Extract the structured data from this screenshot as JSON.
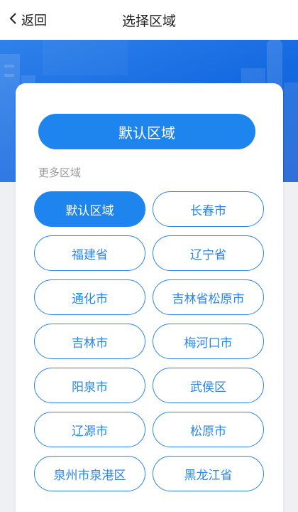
{
  "nav": {
    "back_label": "返回",
    "title": "选择区域"
  },
  "default_button_label": "默认区域",
  "section_label": "更多区域",
  "regions": [
    {
      "label": "默认区域",
      "selected": true
    },
    {
      "label": "长春市",
      "selected": false
    },
    {
      "label": "福建省",
      "selected": false
    },
    {
      "label": "辽宁省",
      "selected": false
    },
    {
      "label": "通化市",
      "selected": false
    },
    {
      "label": "吉林省松原市",
      "selected": false
    },
    {
      "label": "吉林市",
      "selected": false
    },
    {
      "label": "梅河口市",
      "selected": false
    },
    {
      "label": "阳泉市",
      "selected": false
    },
    {
      "label": "武侯区",
      "selected": false
    },
    {
      "label": "辽源市",
      "selected": false
    },
    {
      "label": "松原市",
      "selected": false
    },
    {
      "label": "泉州市泉港区",
      "selected": false
    },
    {
      "label": "黑龙江省",
      "selected": false
    }
  ],
  "colors": {
    "accent": "#1f85ee",
    "banner": "#1468e0",
    "page_bg": "#eef0f3"
  },
  "icons": {
    "back": "chevron-left-icon"
  }
}
